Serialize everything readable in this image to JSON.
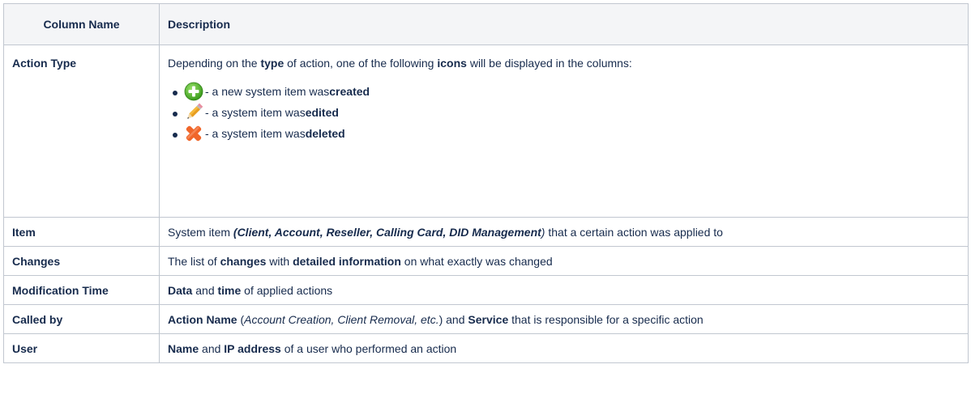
{
  "table": {
    "headers": {
      "column_name": "Column Name",
      "description": "Description"
    },
    "action_type": {
      "name": "Action Type",
      "intro": {
        "t1": "Depending on the ",
        "b1": "type",
        "t2": " of action, one of the following ",
        "b2": "icons",
        "t3": " will be displayed in the columns:"
      },
      "icons": [
        {
          "icon": "plus-circle-icon",
          "text": " - a new system item was ",
          "bold": "created"
        },
        {
          "icon": "pencil-icon",
          "text": " - a system item was ",
          "bold": "edited"
        },
        {
          "icon": "cross-icon",
          "text": " - a system item was ",
          "bold": "deleted"
        }
      ]
    },
    "item": {
      "name": "Item",
      "t1": "System item ",
      "bi": "(Client, Account, Reseller, Calling Card, DID Management",
      "i_close": ")",
      "t2": " that a certain action was applied to"
    },
    "changes": {
      "name": "Changes",
      "t1": "The list of ",
      "b1": "changes",
      "t2": " with ",
      "b2": "detailed information",
      "t3": " on what exactly was changed"
    },
    "modification_time": {
      "name": "Modification Time",
      "b1": "Data",
      "t1": " and ",
      "b2": "time",
      "t2": " of applied actions"
    },
    "called_by": {
      "name": "Called by",
      "b1": "Action Name",
      "t1": " (",
      "i1": "Account Creation, Client Removal, etc.",
      "t2": ") and ",
      "b2": "Service",
      "t3": " that is responsible for a specific action"
    },
    "user": {
      "name": "User",
      "b1": "Name",
      "t1": " and ",
      "b2": "IP address",
      "t2": " of a user who performed an action"
    }
  },
  "colors": {
    "border": "#c1c7d0",
    "header_bg": "#f4f5f7",
    "text": "#172b4d",
    "plus_green": "#4caf2a",
    "cross_orange": "#f26a2e"
  }
}
